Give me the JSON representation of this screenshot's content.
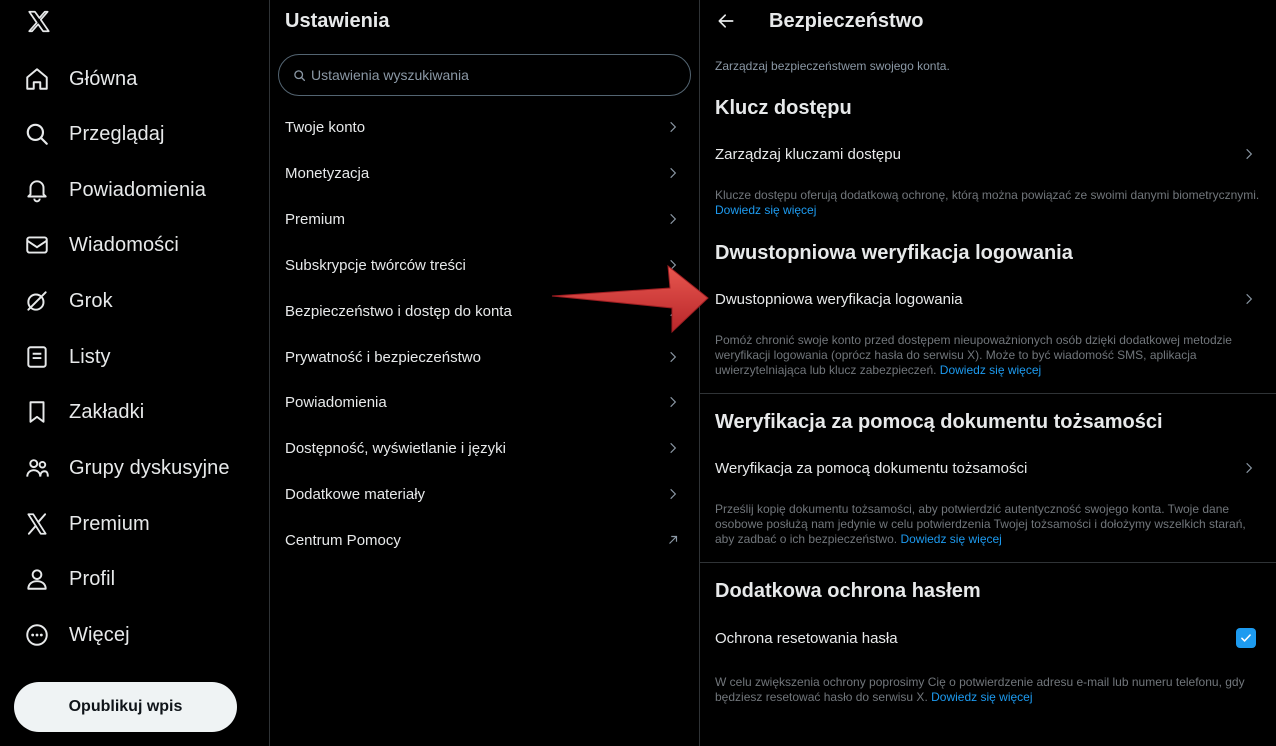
{
  "nav": {
    "items": [
      {
        "label": "Główna"
      },
      {
        "label": "Przeglądaj"
      },
      {
        "label": "Powiadomienia"
      },
      {
        "label": "Wiadomości"
      },
      {
        "label": "Grok"
      },
      {
        "label": "Listy"
      },
      {
        "label": "Zakładki"
      },
      {
        "label": "Grupy dyskusyjne"
      },
      {
        "label": "Premium"
      },
      {
        "label": "Profil"
      },
      {
        "label": "Więcej"
      }
    ],
    "post_button": "Opublikuj wpis"
  },
  "settings": {
    "title": "Ustawienia",
    "search_placeholder": "Ustawienia wyszukiwania",
    "items": [
      {
        "label": "Twoje konto"
      },
      {
        "label": "Monetyzacja"
      },
      {
        "label": "Premium"
      },
      {
        "label": "Subskrypcje twórców treści"
      },
      {
        "label": "Bezpieczeństwo i dostęp do konta"
      },
      {
        "label": "Prywatność i bezpieczeństwo"
      },
      {
        "label": "Powiadomienia"
      },
      {
        "label": "Dostępność, wyświetlanie i języki"
      },
      {
        "label": "Dodatkowe materiały"
      },
      {
        "label": "Centrum Pomocy"
      }
    ]
  },
  "security": {
    "title": "Bezpieczeństwo",
    "subtitle": "Zarządzaj bezpieczeństwem swojego konta.",
    "learn_more": "Dowiedz się więcej",
    "sections": [
      {
        "heading": "Klucz dostępu",
        "row": "Zarządzaj kluczami dostępu",
        "description": "Klucze dostępu oferują dodatkową ochronę, którą można powiązać ze swoimi danymi biometrycznymi."
      },
      {
        "heading": "Dwustopniowa weryfikacja logowania",
        "row": "Dwustopniowa weryfikacja logowania",
        "description": "Pomóż chronić swoje konto przed dostępem nieupoważnionych osób dzięki dodatkowej metodzie weryfikacji logowania (oprócz hasła do serwisu X). Może to być wiadomość SMS, aplikacja uwierzytelniająca lub klucz zabezpieczeń."
      },
      {
        "heading": "Weryfikacja za pomocą dokumentu tożsamości",
        "row": "Weryfikacja za pomocą dokumentu tożsamości",
        "description": "Prześlij kopię dokumentu tożsamości, aby potwierdzić autentyczność swojego konta. Twoje dane osobowe posłużą nam jedynie w celu potwierdzenia Twojej tożsamości i dołożymy wszelkich starań, aby zadbać o ich bezpieczeństwo."
      },
      {
        "heading": "Dodatkowa ochrona hasłem",
        "row": "Ochrona resetowania hasła",
        "checked": true,
        "description": "W celu zwiększenia ochrony poprosimy Cię o potwierdzenie adresu e-mail lub numeru telefonu, gdy będziesz resetować hasło do serwisu X."
      }
    ]
  },
  "colors": {
    "background": "#000000",
    "text": "#e7e9ea",
    "muted": "#71767b",
    "accent": "#1d9bf0",
    "annotation_arrow": "#d93a3a"
  }
}
